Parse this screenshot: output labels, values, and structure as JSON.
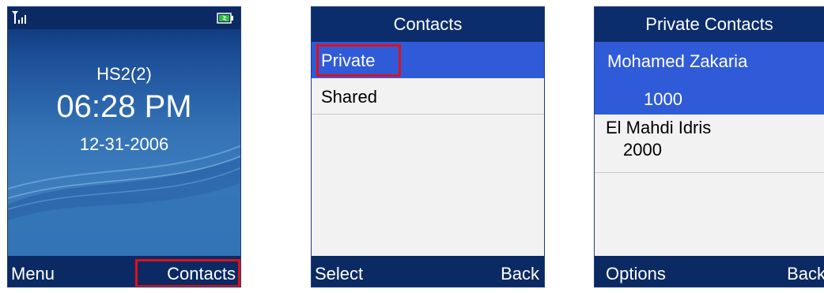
{
  "colors": {
    "header_bg": "#0c2d6b",
    "selection_bg": "#2f5bd8",
    "list_bg": "#f2f2f2",
    "callout_red": "#e0101a"
  },
  "idle_screen": {
    "handset_name": "HS2(2)",
    "time": "06:28 PM",
    "date": "12-31-2006",
    "status_icons": [
      "signal-icon",
      "battery-charging-icon"
    ],
    "softkeys": {
      "left": "Menu",
      "right": "Contacts"
    }
  },
  "contacts_screen": {
    "title": "Contacts",
    "items": [
      {
        "label": "Private",
        "selected": true
      },
      {
        "label": "Shared",
        "selected": false
      }
    ],
    "softkeys": {
      "left": "Select",
      "right": "Back"
    }
  },
  "private_contacts_screen": {
    "title": "Private Contacts",
    "items": [
      {
        "name": "Mohamed Zakaria",
        "number": "1000",
        "selected": true
      },
      {
        "name": "El Mahdi Idris",
        "number": "2000",
        "selected": false
      }
    ],
    "softkeys": {
      "left": "Options",
      "right": "Back"
    }
  }
}
